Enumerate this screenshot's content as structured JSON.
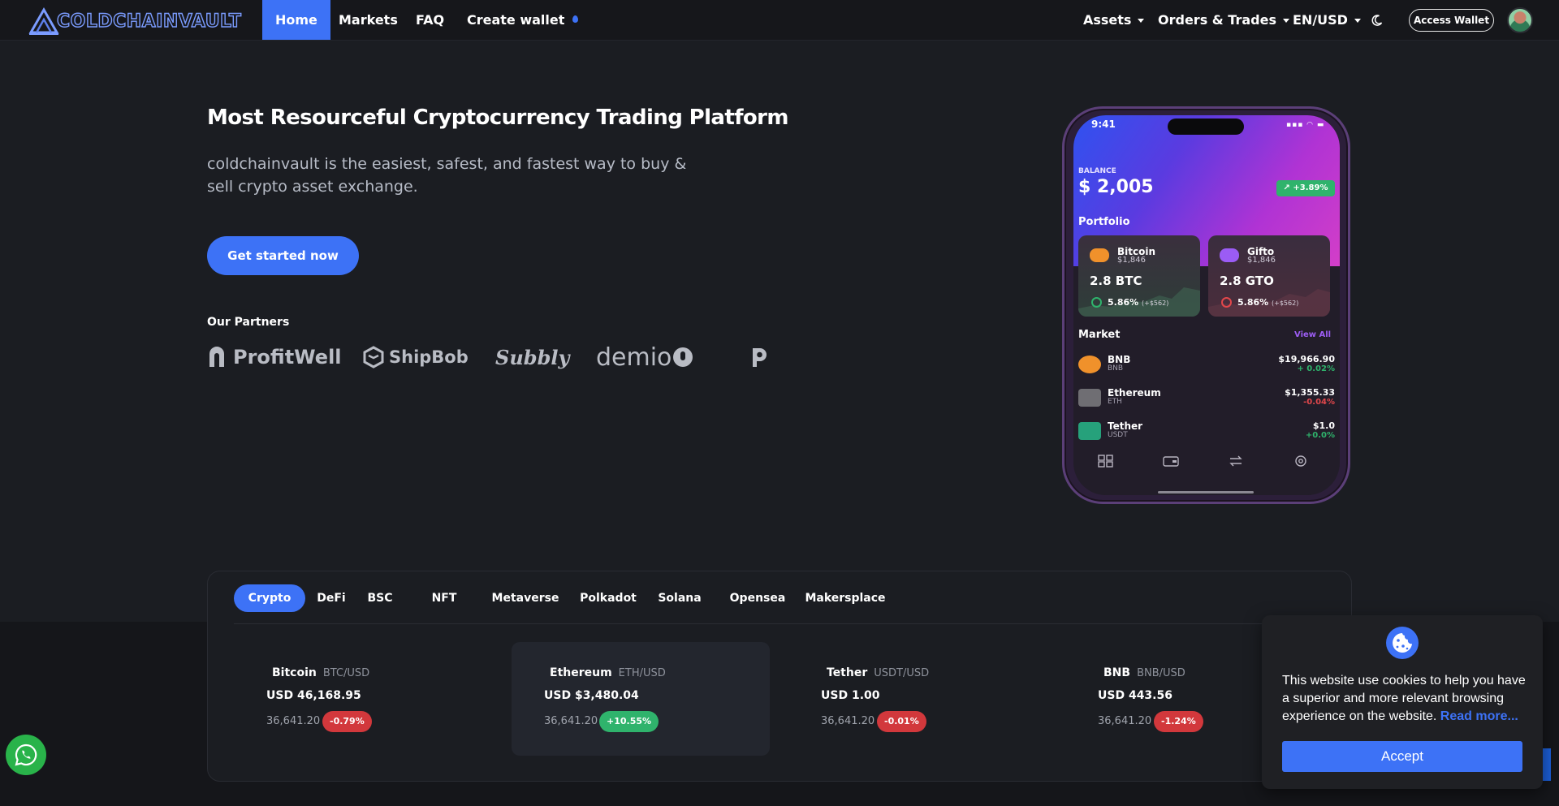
{
  "nav": {
    "logo_text": "COLDCHAINVAULT",
    "links": [
      "Home",
      "Markets",
      "FAQ",
      "Create wallet"
    ],
    "assets_label": "Assets",
    "orders_label": "Orders & Trades",
    "locale_label": "EN/USD",
    "access_wallet": "Access Wallet"
  },
  "hero": {
    "title": "Most Resourceful Cryptocurrency Trading Platform",
    "description": "coldchainvault is the easiest, safest, and fastest way to buy & sell crypto asset exchange.",
    "cta": "Get started now",
    "partners_title": "Our Partners",
    "partners": [
      "ProfitWell",
      "ShipBob",
      "Subbly",
      "demio",
      "P"
    ]
  },
  "phone": {
    "time": "9:41",
    "balance_label": "BALANCE",
    "balance": "$ 2,005",
    "balance_change": "+3.89%",
    "portfolio_label": "Portfolio",
    "cards": [
      {
        "name": "Bitcoin",
        "price": "$1,846",
        "amount": "2.8 BTC",
        "pct": "5.86%",
        "gain": "(+$562)"
      },
      {
        "name": "Gifto",
        "price": "$1,846",
        "amount": "2.8 GTO",
        "pct": "5.86%",
        "gain": "(+$562)"
      }
    ],
    "market_label": "Market",
    "view_all": "View All",
    "market": [
      {
        "name": "BNB",
        "symbol": "BNB",
        "price": "$19,966.90",
        "change": "+ 0.02%"
      },
      {
        "name": "Ethereum",
        "symbol": "ETH",
        "price": "$1,355.33",
        "change": "-0.04%"
      },
      {
        "name": "Tether",
        "symbol": "USDT",
        "price": "$1.0",
        "change": "+0.0%"
      }
    ]
  },
  "market_tabs": [
    "Crypto",
    "DeFi",
    "BSC",
    "NFT",
    "Metaverse",
    "Polkadot",
    "Solana",
    "Opensea",
    "Makersplace"
  ],
  "tickers": [
    {
      "name": "Bitcoin",
      "pair": "BTC/USD",
      "price": "USD 46,168.95",
      "volume": "36,641.20",
      "change": "-0.79%"
    },
    {
      "name": "Ethereum",
      "pair": "ETH/USD",
      "price": "USD $3,480.04",
      "volume": "36,641.20",
      "change": "+10.55%"
    },
    {
      "name": "Tether",
      "pair": "USDT/USD",
      "price": "USD 1.00",
      "volume": "36,641.20",
      "change": "-0.01%"
    },
    {
      "name": "BNB",
      "pair": "BNB/USD",
      "price": "USD 443.56",
      "volume": "36,641.20",
      "change": "-1.24%"
    }
  ],
  "cookie": {
    "text": "This website use cookies to help you have a superior and more relevant browsing experience on the website.",
    "link": "Read more...",
    "accept": "Accept"
  },
  "colors": {
    "accent": "#3d72f6",
    "positive": "#2fb36c",
    "negative": "#d2383c",
    "background": "#1b1d22"
  },
  "icons": [
    "logo-icon",
    "moon-icon",
    "avatar",
    "whatsapp-icon",
    "cookie-icon",
    "chat-icon"
  ]
}
